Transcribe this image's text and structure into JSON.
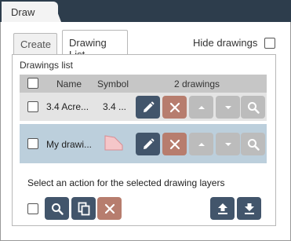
{
  "window": {
    "tab_label": "Draw"
  },
  "tabs": {
    "create": "Create",
    "drawing_list": "Drawing List"
  },
  "hide_drawings_label": "Hide drawings",
  "list": {
    "title": "Drawings list",
    "columns": {
      "name": "Name",
      "symbol": "Symbol",
      "count": "2 drawings"
    },
    "rows": [
      {
        "name": "3.4 Acre...",
        "symbol_text": "3.4 ...",
        "selected": false
      },
      {
        "name": "My drawi...",
        "symbol_shape": "polygon",
        "selected": true
      }
    ]
  },
  "footer": {
    "prompt": "Select an action for the selected drawing layers"
  },
  "colors": {
    "header": "#2d3d4c",
    "button_dark": "#42556b",
    "button_delete": "#b77d6e",
    "button_disabled": "#bcbcbc",
    "row_selected": "#bccfdc",
    "polygon_fill": "#f5c6c9"
  },
  "icons": [
    "pencil-icon",
    "close-icon",
    "arrow-up-icon",
    "arrow-down-icon",
    "search-icon",
    "copy-icon",
    "upload-icon",
    "download-icon"
  ]
}
